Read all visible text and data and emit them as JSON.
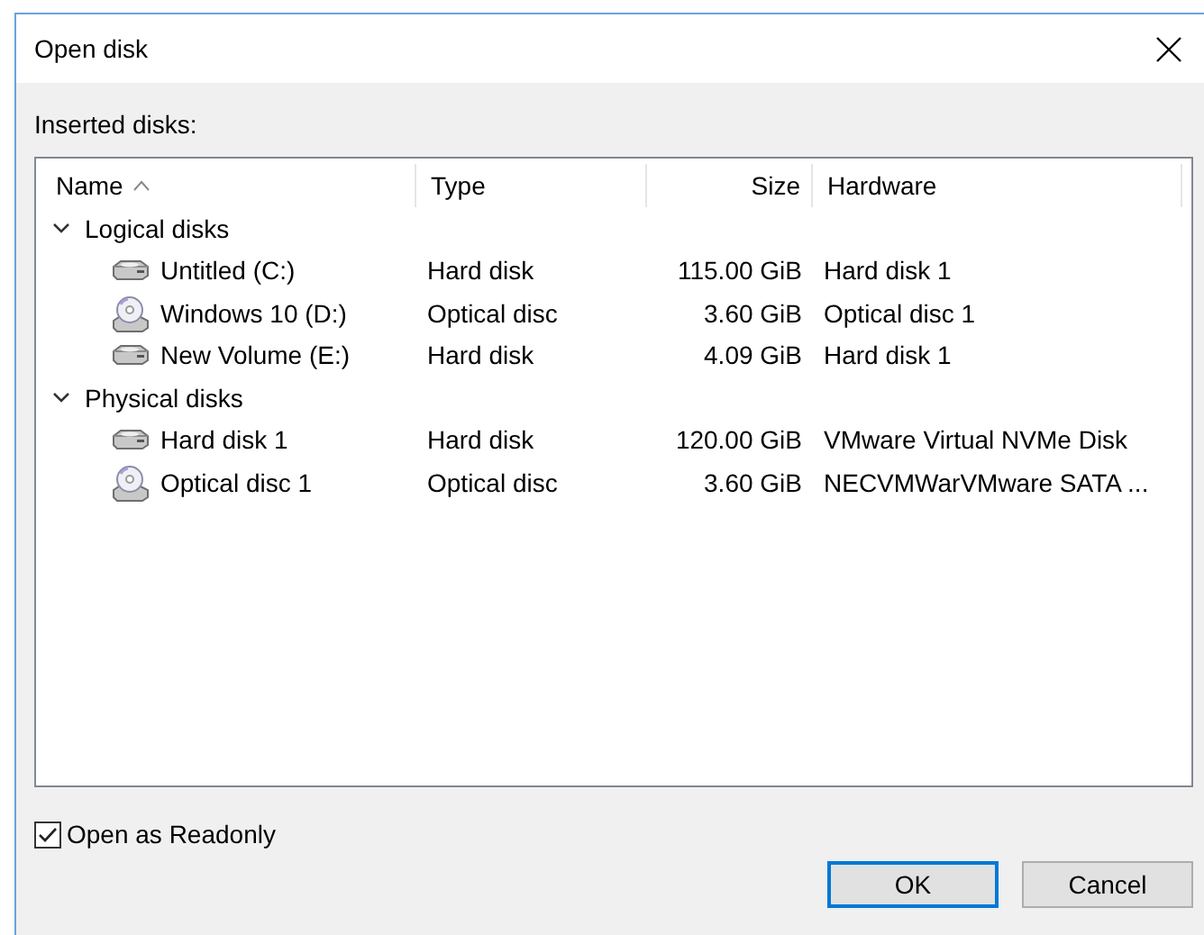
{
  "window": {
    "title": "Open disk"
  },
  "list_label": "Inserted disks:",
  "table": {
    "columns": [
      {
        "label": "Name",
        "sorted": true
      },
      {
        "label": "Type",
        "sorted": false
      },
      {
        "label": "Size",
        "sorted": false
      },
      {
        "label": "Hardware",
        "sorted": false
      }
    ],
    "groups": [
      {
        "label": "Logical disks",
        "expanded": true,
        "children": [
          {
            "kind": "hdd",
            "name": "Untitled (C:)",
            "type": "Hard disk",
            "size": "115.00 GiB",
            "hardware": "Hard disk 1"
          },
          {
            "kind": "optical",
            "name": "Windows 10 (D:)",
            "type": "Optical disc",
            "size": "3.60 GiB",
            "hardware": "Optical disc 1"
          },
          {
            "kind": "hdd",
            "name": "New Volume (E:)",
            "type": "Hard disk",
            "size": "4.09 GiB",
            "hardware": "Hard disk 1"
          }
        ]
      },
      {
        "label": "Physical disks",
        "expanded": true,
        "children": [
          {
            "kind": "hdd",
            "name": "Hard disk 1",
            "type": "Hard disk",
            "size": "120.00 GiB",
            "hardware": "VMware Virtual NVMe Disk"
          },
          {
            "kind": "optical",
            "name": "Optical disc 1",
            "type": "Optical disc",
            "size": "3.60 GiB",
            "hardware": "NECVMWarVMware SATA ..."
          }
        ]
      }
    ]
  },
  "readonly": {
    "label": "Open as Readonly",
    "checked": true
  },
  "buttons": [
    {
      "label": "OK",
      "default": true
    },
    {
      "label": "Cancel",
      "default": false
    }
  ]
}
